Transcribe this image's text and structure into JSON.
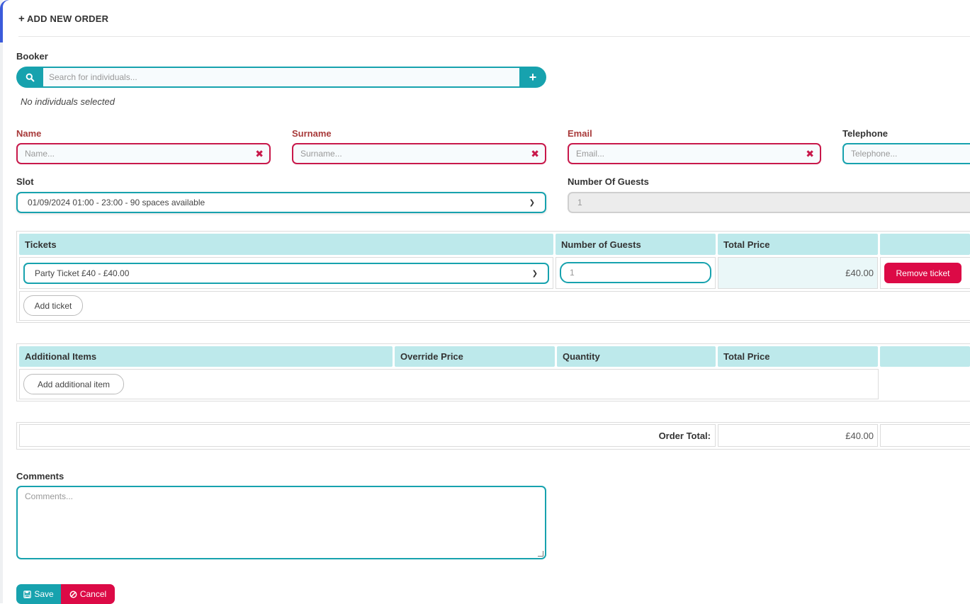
{
  "header": {
    "title": "ADD NEW ORDER",
    "icon": "plus-icon"
  },
  "booker": {
    "label": "Booker",
    "search_placeholder": "Search for individuals...",
    "empty_text": "No individuals selected"
  },
  "fields": {
    "name": {
      "label": "Name",
      "placeholder": "Name...",
      "required": true
    },
    "surname": {
      "label": "Surname",
      "placeholder": "Surname...",
      "required": true
    },
    "email": {
      "label": "Email",
      "placeholder": "Email...",
      "required": true
    },
    "telephone": {
      "label": "Telephone",
      "placeholder": "Telephone..."
    }
  },
  "slot": {
    "label": "Slot",
    "value": "01/09/2024 01:00 - 23:00 - 90 spaces available"
  },
  "guests": {
    "label": "Number Of Guests",
    "value": "1"
  },
  "tickets_table": {
    "headers": [
      "Tickets",
      "Number of Guests",
      "Total Price"
    ],
    "rows": [
      {
        "ticket": "Party Ticket £40 - £40.00",
        "guests": "1",
        "total": "£40.00",
        "remove_label": "Remove ticket"
      }
    ],
    "add_label": "Add ticket"
  },
  "items_table": {
    "headers": [
      "Additional Items",
      "Override Price",
      "Quantity",
      "Total Price"
    ],
    "add_label": "Add additional item"
  },
  "order_total": {
    "label": "Order Total:",
    "value": "£40.00"
  },
  "comments": {
    "label": "Comments",
    "placeholder": "Comments..."
  },
  "actions": {
    "save_label": "Save",
    "cancel_label": "Cancel"
  },
  "colors": {
    "teal": "#17a2ae",
    "red": "#dc0a46",
    "header_bg": "#bde9eb",
    "required_label": "#a83a3a"
  }
}
